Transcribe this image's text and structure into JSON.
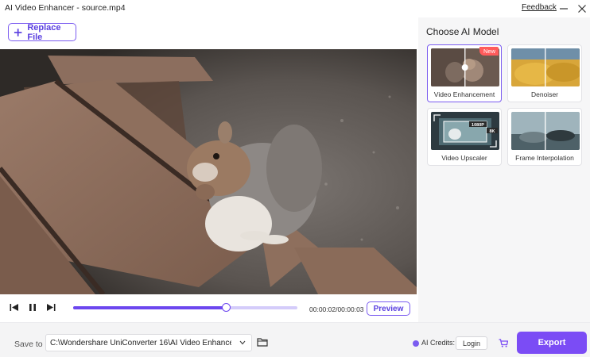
{
  "window": {
    "title": "AI Video Enhancer - source.mp4",
    "feedback_label": "Feedback"
  },
  "toolbar": {
    "replace_label": "Replace File"
  },
  "player": {
    "current_time": "00:00:02",
    "total_time": "00:00:03",
    "timecode": "00:00:02/00:00:03",
    "progress": 0.68,
    "preview_label": "Preview"
  },
  "panel": {
    "title": "Choose AI Model",
    "models": [
      {
        "label": "Video Enhancement",
        "selected": true,
        "badge": "New"
      },
      {
        "label": "Denoiser",
        "selected": false
      },
      {
        "label": "Video Upscaler",
        "selected": false,
        "thumb_tags": [
          "1080P",
          "8K"
        ]
      },
      {
        "label": "Frame Interpolation",
        "selected": false
      }
    ]
  },
  "footer": {
    "save_label": "Save to",
    "save_path": "C:\\Wondershare UniConverter 16\\AI Video Enhance",
    "credits_label": "AI Credits:",
    "login_label": "Login",
    "export_label": "Export"
  },
  "colors": {
    "accent": "#7b4cf5",
    "accent_border": "#7b5cf0",
    "badge_red": "#ff5b5b"
  }
}
